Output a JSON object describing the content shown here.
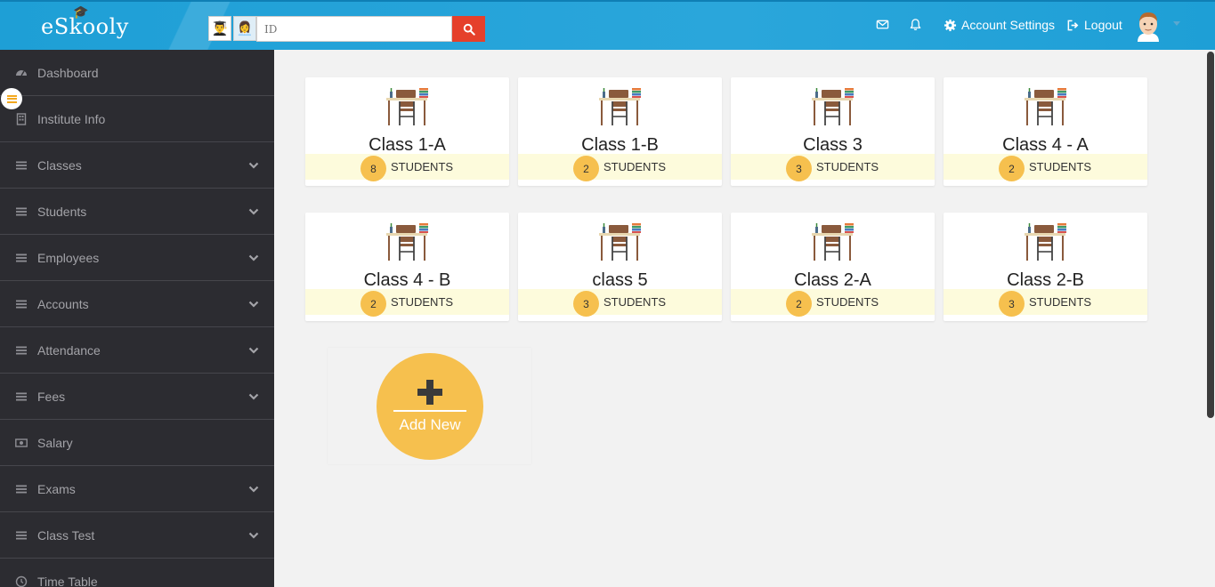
{
  "header": {
    "logo_text": "eSkooly",
    "search_placeholder": "ID",
    "account_settings_label": "Account Settings",
    "logout_label": "Logout"
  },
  "sidebar": {
    "items": [
      {
        "label": "Dashboard",
        "icon": "dashboard-icon",
        "expandable": false
      },
      {
        "label": "Institute Info",
        "icon": "building-icon",
        "expandable": false
      },
      {
        "label": "Classes",
        "icon": "menu-icon",
        "expandable": true
      },
      {
        "label": "Students",
        "icon": "menu-icon",
        "expandable": true
      },
      {
        "label": "Employees",
        "icon": "menu-icon",
        "expandable": true
      },
      {
        "label": "Accounts",
        "icon": "menu-icon",
        "expandable": true
      },
      {
        "label": "Attendance",
        "icon": "menu-icon",
        "expandable": true
      },
      {
        "label": "Fees",
        "icon": "menu-icon",
        "expandable": true
      },
      {
        "label": "Salary",
        "icon": "money-icon",
        "expandable": false
      },
      {
        "label": "Exams",
        "icon": "menu-icon",
        "expandable": true
      },
      {
        "label": "Class Test",
        "icon": "menu-icon",
        "expandable": true
      },
      {
        "label": "Time Table",
        "icon": "clock-icon",
        "expandable": false
      }
    ]
  },
  "classes": [
    {
      "name": "Class 1-A",
      "count": "8",
      "students_label": "STUDENTS"
    },
    {
      "name": "Class 1-B",
      "count": "2",
      "students_label": "STUDENTS"
    },
    {
      "name": "Class 3",
      "count": "3",
      "students_label": "STUDENTS"
    },
    {
      "name": "Class 4 - A",
      "count": "2",
      "students_label": "STUDENTS"
    },
    {
      "name": "Class 4 - B",
      "count": "2",
      "students_label": "STUDENTS"
    },
    {
      "name": "class 5",
      "count": "3",
      "students_label": "STUDENTS"
    },
    {
      "name": "Class 2-A",
      "count": "2",
      "students_label": "STUDENTS"
    },
    {
      "name": "Class 2-B",
      "count": "3",
      "students_label": "STUDENTS"
    }
  ],
  "add_new": {
    "label": "Add New"
  },
  "colors": {
    "header": "#2aa6db",
    "sidebar": "#2c2c31",
    "accent": "#f6c04e",
    "search_button": "#e5402b",
    "student_band": "#fdfbdc"
  }
}
